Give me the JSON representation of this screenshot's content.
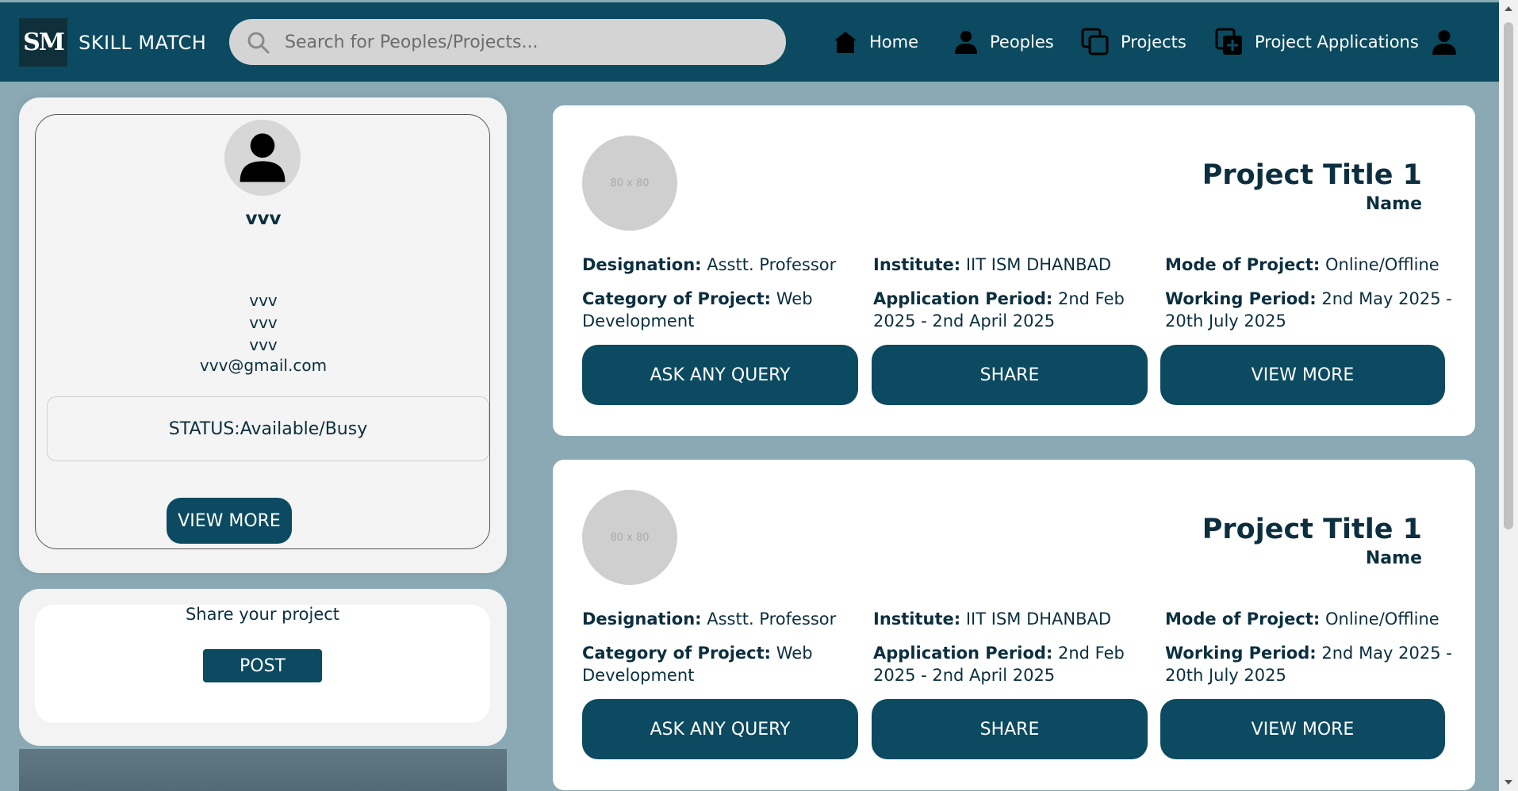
{
  "navbar": {
    "logo_text": "SM",
    "brand": "SKILL MATCH",
    "search_placeholder": "Search for Peoples/Projects...",
    "items": [
      {
        "label": "Home",
        "icon": "home-icon"
      },
      {
        "label": "Peoples",
        "icon": "person-icon"
      },
      {
        "label": "Projects",
        "icon": "projects-icon"
      },
      {
        "label": "Project Applications",
        "icon": "add-application-icon"
      }
    ],
    "profile_icon": "user-icon"
  },
  "profile": {
    "name": "vvv",
    "lines": [
      "vvv",
      "vvv",
      "vvv"
    ],
    "email": "vvv@gmail.com",
    "status": "STATUS:Available/Busy",
    "view_more": "VIEW MORE"
  },
  "share": {
    "label": "Share your project",
    "post": "POST"
  },
  "projects": [
    {
      "image_placeholder": "80 x 80",
      "title": "Project Title 1",
      "name": "Name",
      "designation_label": "Designation:",
      "designation": "Asstt. Professor",
      "institute_label": "Institute:",
      "institute": "IIT ISM DHANBAD",
      "mode_label": "Mode of Project:",
      "mode": "Online/Offline",
      "category_label": "Category of Project:",
      "category": "Web Development",
      "application_label": "Application Period:",
      "application": "2nd Feb 2025 - 2nd April 2025",
      "working_label": "Working Period:",
      "working": "2nd May 2025 - 20th July 2025",
      "btn_query": "ASK ANY QUERY",
      "btn_share": "SHARE",
      "btn_more": "VIEW MORE"
    },
    {
      "image_placeholder": "80 x 80",
      "title": "Project Title 1",
      "name": "Name",
      "designation_label": "Designation:",
      "designation": "Asstt. Professor",
      "institute_label": "Institute:",
      "institute": "IIT ISM DHANBAD",
      "mode_label": "Mode of Project:",
      "mode": "Online/Offline",
      "category_label": "Category of Project:",
      "category": "Web Development",
      "application_label": "Application Period:",
      "application": "2nd Feb 2025 - 2nd April 2025",
      "working_label": "Working Period:",
      "working": "2nd May 2025 - 20th July 2025",
      "btn_query": "ASK ANY QUERY",
      "btn_share": "SHARE",
      "btn_more": "VIEW MORE"
    }
  ],
  "colors": {
    "primary": "#0b4a60",
    "background": "#8aa9b4",
    "card": "#ffffff",
    "text": "#0b2f3f"
  }
}
